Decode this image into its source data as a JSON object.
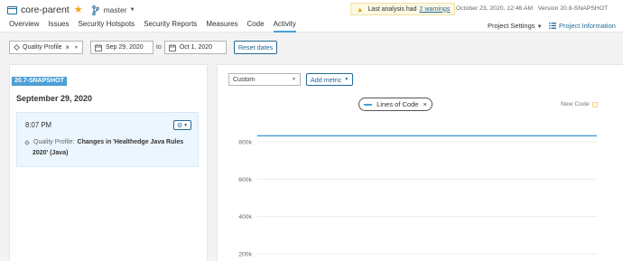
{
  "header": {
    "project_name": "core-parent",
    "branch": "master",
    "nav": [
      "Overview",
      "Issues",
      "Security Hotspots",
      "Security Reports",
      "Measures",
      "Code",
      "Activity"
    ],
    "active_nav": "Activity",
    "warning_text": "Last analysis had",
    "warning_link": "2 warnings",
    "analysis_date": "October 23, 2020, 12:46 AM",
    "version": "Version 20.8-SNAPSHOT",
    "project_settings": "Project Settings",
    "project_information": "Project Information"
  },
  "filters": {
    "category": "Quality Profile",
    "from_date": "Sep 29, 2020",
    "to_label": "to",
    "to_date": "Oct 1, 2020",
    "reset_label": "Reset dates"
  },
  "history": {
    "version_tag": "20.7-SNAPSHOT",
    "date": "September 29, 2020",
    "event": {
      "time": "8:07 PM",
      "category": "Quality Profile:",
      "change_line1": "Changes in 'Healthedge Java Rules",
      "change_line2": "2020' (Java)"
    }
  },
  "graph": {
    "graph_type": "Custom",
    "add_metric": "Add metric",
    "legend_metric": "Lines of Code",
    "legend_remove": "×",
    "new_code_label": "New Code"
  },
  "chart_data": {
    "type": "line",
    "series": [
      {
        "name": "Lines of Code",
        "values": [
          832000,
          832000,
          832000,
          832000,
          832000
        ]
      }
    ],
    "y_ticks": [
      800000,
      600000,
      400000,
      200000
    ],
    "y_tick_labels": [
      "800k",
      "600k",
      "400k",
      "200k"
    ],
    "grid": true,
    "color": "#4b9fd5"
  },
  "colors": {
    "accent": "#236a97",
    "series_blue": "#4b9fd5",
    "warning_bg": "#fcf8e3",
    "star": "#f4a21b"
  }
}
